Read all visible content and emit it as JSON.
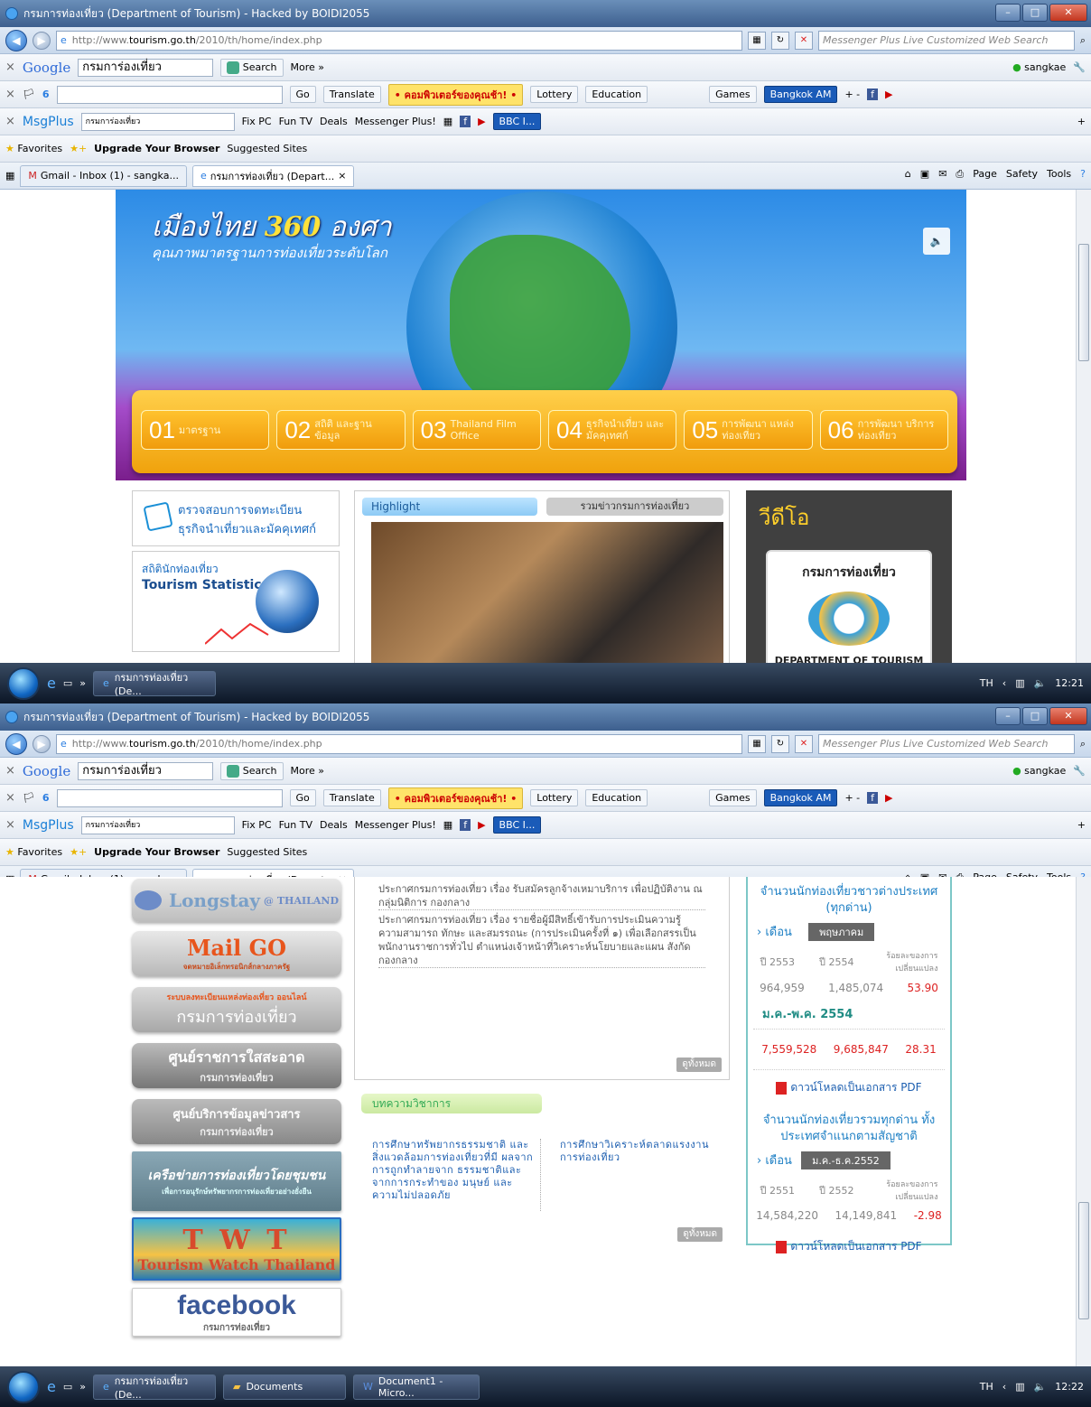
{
  "window": {
    "title": "กรมการท่องเที่ยว (Department of Tourism) - Hacked by BOIDI2055",
    "url_prefix": "http://www.",
    "url_domain": "tourism.go.th",
    "url_path": "/2010/th/home/index.php",
    "search_placeholder": "Messenger Plus Live Customized Web Search"
  },
  "google_bar": {
    "logo": "Google",
    "query": "กรมการ่องเที่ยว",
    "search_label": "Search",
    "more_label": "More »",
    "user": "sangkae"
  },
  "toolbar2": {
    "go": "Go",
    "translate": "Translate",
    "promo": "• คอมพิวเตอร์ของคุณช้า! •",
    "lottery": "Lottery",
    "education": "Education",
    "games": "Games",
    "station": "Bangkok AM",
    "plusminus": "+ -"
  },
  "toolbar3": {
    "brand": "MsgPlus",
    "query": "กรมการ่องเที่ยว",
    "fixpc": "Fix PC",
    "funtv": "Fun TV",
    "deals": "Deals",
    "messenger": "Messenger Plus!",
    "bbc": "BBC I..."
  },
  "favbar": {
    "favorites": "Favorites",
    "upgrade": "Upgrade Your Browser",
    "suggested": "Suggested Sites"
  },
  "tabs": [
    {
      "label": "Gmail - Inbox (1) - sangka..."
    },
    {
      "label": "กรมการท่องเที่ยว (Depart..."
    }
  ],
  "commands": [
    "Page",
    "Safety",
    "Tools"
  ],
  "banner": {
    "line1_a": "เมืองไทย",
    "line1_num": "360",
    "line1_b": "องศา",
    "line2": "คุณภาพมาตรฐานการท่องเที่ยวระดับโลก"
  },
  "menu": [
    {
      "num": "01",
      "text": "มาตรฐาน"
    },
    {
      "num": "02",
      "text": "สถิติ และฐานข้อมูล"
    },
    {
      "num": "03",
      "text": "Thailand Film Office"
    },
    {
      "num": "04",
      "text": "ธุรกิจนำเที่ยว และมัคคุเทศก์"
    },
    {
      "num": "05",
      "text": "การพัฒนา แหล่งท่องเที่ยว"
    },
    {
      "num": "06",
      "text": "การพัฒนา บริการท่องเที่ยว"
    }
  ],
  "left_boxes": {
    "check_line1": "ตรวจสอบการจดทะเบียน",
    "check_line2": "ธุรกิจนำเที่ยวและมัคคุเทศก์",
    "stats_th": "สถิตินักท่องเที่ยว",
    "stats_en": "Tourism Statistics"
  },
  "highlight": {
    "tab1": "Highlight",
    "tab2": "รวมข่าวกรมการท่องเที่ยว"
  },
  "video": {
    "title": "วีดีโอ",
    "logo_th": "กรมการท่องเที่ยว",
    "logo_en": "DEPARTMENT OF TOURISM"
  },
  "taskbar1": {
    "item": "กรมการท่องเที่ยว (De...",
    "lang": "TH",
    "time": "12:21"
  },
  "taskbar2": {
    "items": [
      "กรมการท่องเที่ยว (De...",
      "Documents",
      "Document1 - Micro..."
    ],
    "lang": "TH",
    "time": "12:22"
  },
  "side_banners": {
    "longstay": "Longstay",
    "longstay_sub": "@ THAILAND",
    "mailgo": "Mail GO",
    "mailgo_sub": "จดหมายอิเล็กทรอนิกส์กลางภาครัฐ",
    "online_top": "ระบบลงทะเบียนแหล่งท่องเที่ยว ออนไลน์",
    "online_main": "กรมการท่องเที่ยว",
    "clean_main": "ศูนย์ราชการใสสะอาด",
    "clean_sub": "กรมการท่องเที่ยว",
    "info_main": "ศูนย์บริการข้อมูลข่าวสาร",
    "info_sub": "กรมการท่องเที่ยว",
    "network_main": "เครือข่ายการท่องเที่ยวโดยชุมชน",
    "network_sub": "เพื่อการอนุรักษ์ทรัพยากรการท่องเที่ยวอย่างยั่งยืน",
    "twt_main": "T W T",
    "twt_sub": "Tourism Watch Thailand",
    "facebook": "facebook",
    "facebook_sub": "กรมการท่องเที่ยว"
  },
  "news": [
    "ประกาศกรมการท่องเที่ยว เรื่อง รับสมัครลูกจ้างเหมาบริการ เพื่อปฏิบัติงาน ณ กลุ่มนิติการ กองกลาง",
    "ประกาศกรมการท่องเที่ยว เรื่อง รายชื่อผู้มีสิทธิ์เข้ารับการประเมินความรู้ ความสามารถ ทักษะ และสมรรถนะ (การประเมินครั้งที่ ๑) เพื่อเลือกสรรเป็นพนักงานราชการทั่วไป ตำแหน่งเจ้าหน้าที่วิเคราะห์นโยบายและแผน สังกัดกองกลาง"
  ],
  "more_label": "ดูทั้งหมด",
  "articles": {
    "title": "บทความวิชาการ",
    "a1": "การศึกษาทรัพยากรธรรมชาติ และสิ่งแวดล้อมการท่องเที่ยวที่มี ผลจากการถูกทำลายจาก ธรรมชาติและจากการกระทำของ มนุษย์ และความไม่ปลอดภัย",
    "a2": "การศึกษาวิเคราะห์ตลาดแรงงาน การท่องเที่ยว"
  },
  "stats1": {
    "heading": "จำนวนนักท่องเที่ยวชาวต่างประเทศ (ทุกด่าน)",
    "month_label": "เดือน",
    "month_value": "พฤษภาคม",
    "y1": "ปี 2553",
    "y2": "ปี 2554",
    "pct_label": "ร้อยละของการเปลี่ยนแปลง",
    "v1": "964,959",
    "v2": "1,485,074",
    "pct": "53.90",
    "period": "ม.ค.-พ.ค. 2554",
    "p1": "7,559,528",
    "p2": "9,685,847",
    "ppct": "28.31",
    "pdf": "ดาวน์โหลดเป็นเอกสาร PDF"
  },
  "stats2": {
    "heading": "จำนวนนักท่องเที่ยวรวมทุกด่าน ทั้งประเทศจำแนกตามสัญชาติ",
    "month_label": "เดือน",
    "month_value": "ม.ค.-ธ.ค.2552",
    "y1": "ปี 2551",
    "y2": "ปี 2552",
    "pct_label": "ร้อยละของการเปลี่ยนแปลง",
    "v1": "14,584,220",
    "v2": "14,149,841",
    "pct": "-2.98",
    "pdf": "ดาวน์โหลดเป็นเอกสาร PDF"
  }
}
